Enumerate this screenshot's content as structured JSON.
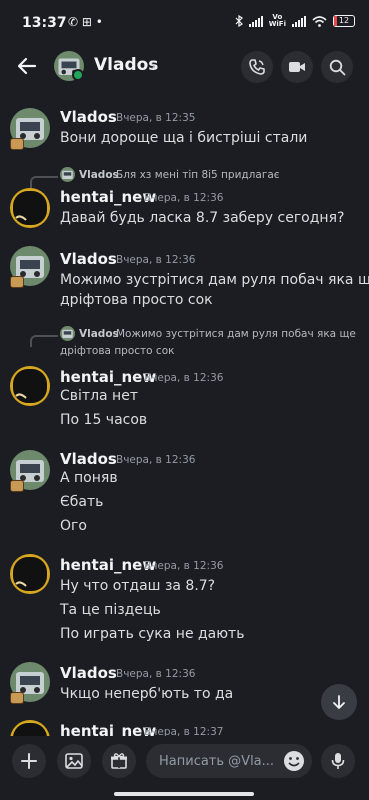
{
  "status_bar": {
    "time": "13:37",
    "left_icons": "✆ ⊞ •",
    "volte": "Vo\nWiFi",
    "battery": "12",
    "colors": {
      "battery_low": "#e84a4a"
    }
  },
  "header": {
    "name": "Vlados",
    "chevron": "›",
    "icons": [
      "back-arrow-icon",
      "phone-icon",
      "video-icon",
      "search-icon"
    ],
    "status": "online"
  },
  "messages": [
    {
      "type": "message",
      "author": "Vlados",
      "timestamp": "Вчера, в 12:35",
      "lines": [
        "Вони дороще ща і бистріші стали"
      ]
    },
    {
      "type": "message",
      "author": "hentai_new",
      "timestamp": "Вчера, в 12:36",
      "reply": {
        "author": "Vlados",
        "text": "Бля хз мені тіп 8і5 придлагає"
      },
      "lines": [
        "Давай будь ласка 8.7 заберу сегодня?"
      ]
    },
    {
      "type": "message",
      "author": "Vlados",
      "timestamp": "Вчера, в 12:36",
      "lines": [
        "Можимо зустрітися дам руля побач яка ще",
        "дріфтова просто сок"
      ]
    },
    {
      "type": "message",
      "author": "hentai_new",
      "timestamp": "Вчера, в 12:36",
      "reply": {
        "author": "Vlados",
        "text": "Можимо зустрітися дам руля побач яка ще",
        "text2": "дріфтова просто сок"
      },
      "lines": [
        "Світла нет",
        "По 15 часов"
      ]
    },
    {
      "type": "message",
      "author": "Vlados",
      "timestamp": "Вчера, в 12:36",
      "lines": [
        "А поняв",
        "Єбать",
        "Ого"
      ]
    },
    {
      "type": "message",
      "author": "hentai_new",
      "timestamp": "Вчера, в 12:36",
      "lines": [
        "Ну что отдаш за 8.7?",
        "Та це піздець",
        "По играть сука не дають"
      ]
    },
    {
      "type": "message",
      "author": "Vlados",
      "timestamp": "Вчера, в 12:36",
      "lines": [
        "Чкщо неперб'ють то да"
      ]
    },
    {
      "type": "message",
      "author": "hentai_new",
      "timestamp": "Вчера, в 12:37",
      "lines": []
    }
  ],
  "composer": {
    "placeholder": "Написать @Vla...",
    "icons": [
      "plus-icon",
      "image-icon",
      "gift-icon",
      "emoji-icon",
      "microphone-icon"
    ]
  },
  "colors": {
    "background": "#1c1d22",
    "online": "#23a55a",
    "button_bg": "#2b2d33"
  }
}
